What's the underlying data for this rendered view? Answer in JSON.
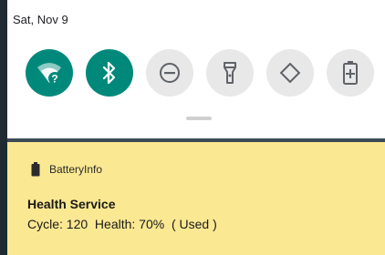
{
  "status": {
    "date": "Sat, Nov 9"
  },
  "quick_settings": {
    "tiles": [
      {
        "name": "wifi",
        "icon": "wifi-unknown-icon",
        "active": true
      },
      {
        "name": "bluetooth",
        "icon": "bluetooth-icon",
        "active": true
      },
      {
        "name": "do-not-disturb",
        "icon": "do-not-disturb-icon",
        "active": false
      },
      {
        "name": "flashlight",
        "icon": "flashlight-icon",
        "active": false
      },
      {
        "name": "auto-rotate",
        "icon": "auto-rotate-icon",
        "active": false
      },
      {
        "name": "battery-saver",
        "icon": "battery-saver-icon",
        "active": false
      }
    ]
  },
  "notification": {
    "app_name": "BatteryInfo",
    "title": "Health Service",
    "text": "Cycle: 120  Health: 70%  ( Used )"
  },
  "colors": {
    "tile_active": "#00897b",
    "tile_inactive": "#e8e8e8",
    "notification_bg": "#fbe892"
  }
}
